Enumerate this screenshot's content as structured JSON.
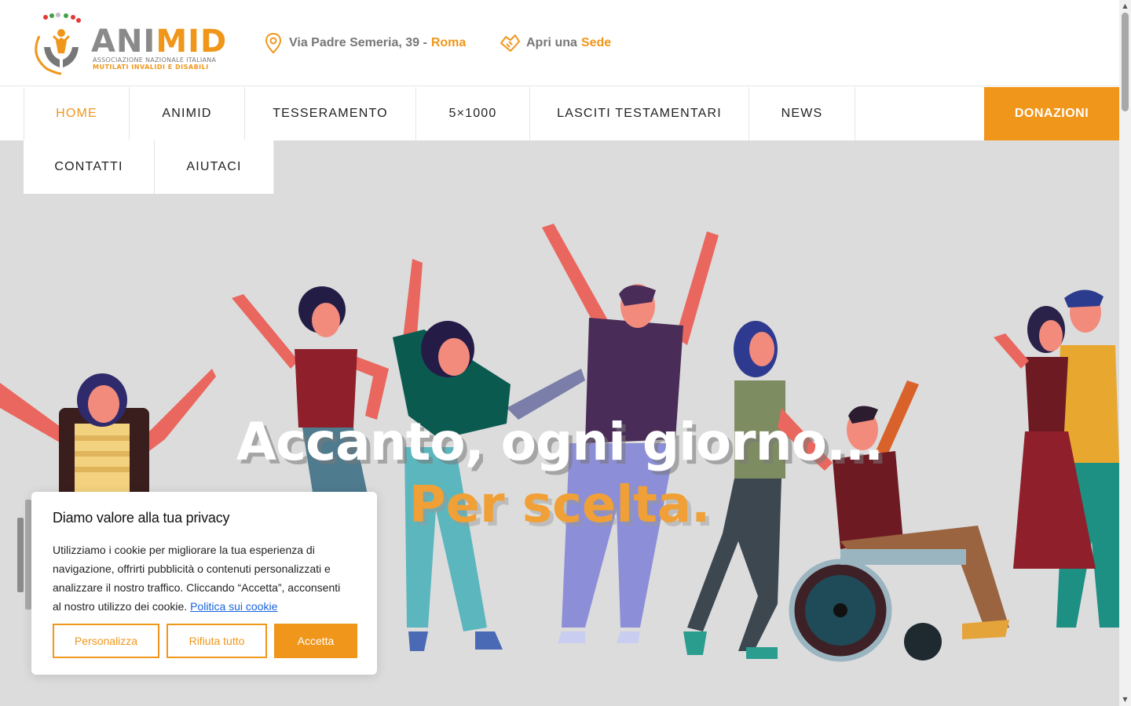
{
  "brand": {
    "name_part1": "ANI",
    "name_part2": "MID",
    "subtitle_line1": "ASSOCIAZIONE NAZIONALE ITALIANA",
    "subtitle_line2": "MUTILATI INVALIDI E DISABILI",
    "accent_color": "#f0961b"
  },
  "header": {
    "address_text": "Via Padre Semeria, 39 -",
    "address_city": "Roma",
    "open_text": "Apri una",
    "open_link": "Sede"
  },
  "nav": {
    "items": [
      {
        "label": "HOME",
        "active": true
      },
      {
        "label": "ANIMID"
      },
      {
        "label": "TESSERAMENTO"
      },
      {
        "label": "5×1000"
      },
      {
        "label": "LASCITI TESTAMENTARI"
      },
      {
        "label": "NEWS"
      },
      {
        "label": "CONTATTI"
      },
      {
        "label": "AIUTACI"
      }
    ],
    "donate_label": "DONAZIONI"
  },
  "hero": {
    "headline": "Accanto, ogni giorno...",
    "subheadline": "Per scelta."
  },
  "cookie": {
    "title": "Diamo valore alla tua privacy",
    "body": "Utilizziamo i cookie per migliorare la tua esperienza di navigazione, offrirti pubblicità o contenuti personalizzati e analizzare il nostro traffico. Cliccando “Accetta”, acconsenti al nostro utilizzo dei cookie.",
    "policy_link": "Politica sui cookie",
    "btn_customize": "Personalizza",
    "btn_reject": "Rifiuta tutto",
    "btn_accept": "Accetta"
  }
}
